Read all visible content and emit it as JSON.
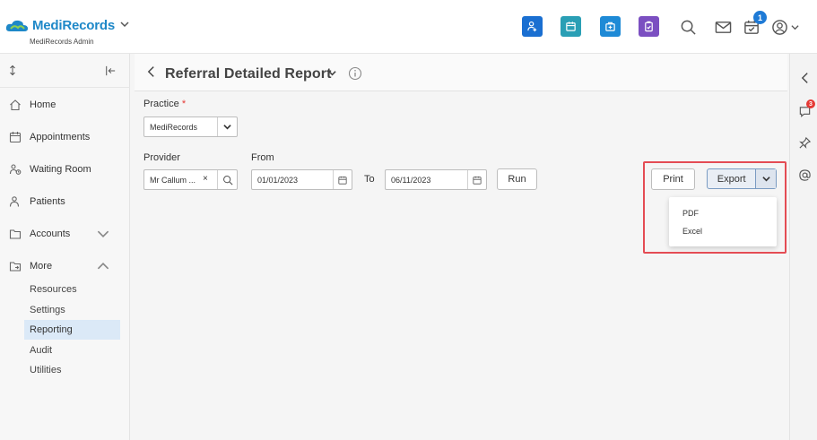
{
  "app": {
    "name": "MediRecords",
    "subtitle": "MediRecords Admin"
  },
  "header": {
    "quick_actions": [
      {
        "icon": "add-patient-icon",
        "color": "#1a6fd1"
      },
      {
        "icon": "calendar-icon",
        "color": "#2a9fb5"
      },
      {
        "icon": "medical-kit-icon",
        "color": "#1e8ad6"
      },
      {
        "icon": "clipboard-icon",
        "color": "#7b4fc1"
      }
    ],
    "notification_count": "1"
  },
  "sidebar": {
    "items": [
      {
        "label": "Home",
        "icon": "home-icon"
      },
      {
        "label": "Appointments",
        "icon": "calendar-icon"
      },
      {
        "label": "Waiting Room",
        "icon": "waiting-room-icon"
      },
      {
        "label": "Patients",
        "icon": "patients-icon"
      },
      {
        "label": "Accounts",
        "icon": "folder-icon"
      },
      {
        "label": "More",
        "icon": "folder-arrow-icon"
      }
    ],
    "sub_items": [
      "Resources",
      "Settings",
      "Reporting",
      "Audit",
      "Utilities"
    ],
    "active_sub_item": "Reporting"
  },
  "right_rail": {
    "comments_badge": "3"
  },
  "page": {
    "title": "Referral Detailed Report"
  },
  "form": {
    "practice_label": "Practice",
    "practice_required_mark": "*",
    "practice_value": "MediRecords",
    "provider_label": "Provider",
    "provider_value": "Mr Callum ...",
    "provider_clear": "×",
    "from_label": "From",
    "from_value": "01/01/2023",
    "to_label": "To",
    "to_value": "06/11/2023",
    "run_label": "Run"
  },
  "actions": {
    "print_label": "Print",
    "export_label": "Export",
    "export_options": [
      "PDF",
      "Excel"
    ]
  },
  "colors": {
    "accent": "#1e88c8",
    "highlight_border": "#e44c54",
    "active_item_bg": "#dbe9f7"
  }
}
